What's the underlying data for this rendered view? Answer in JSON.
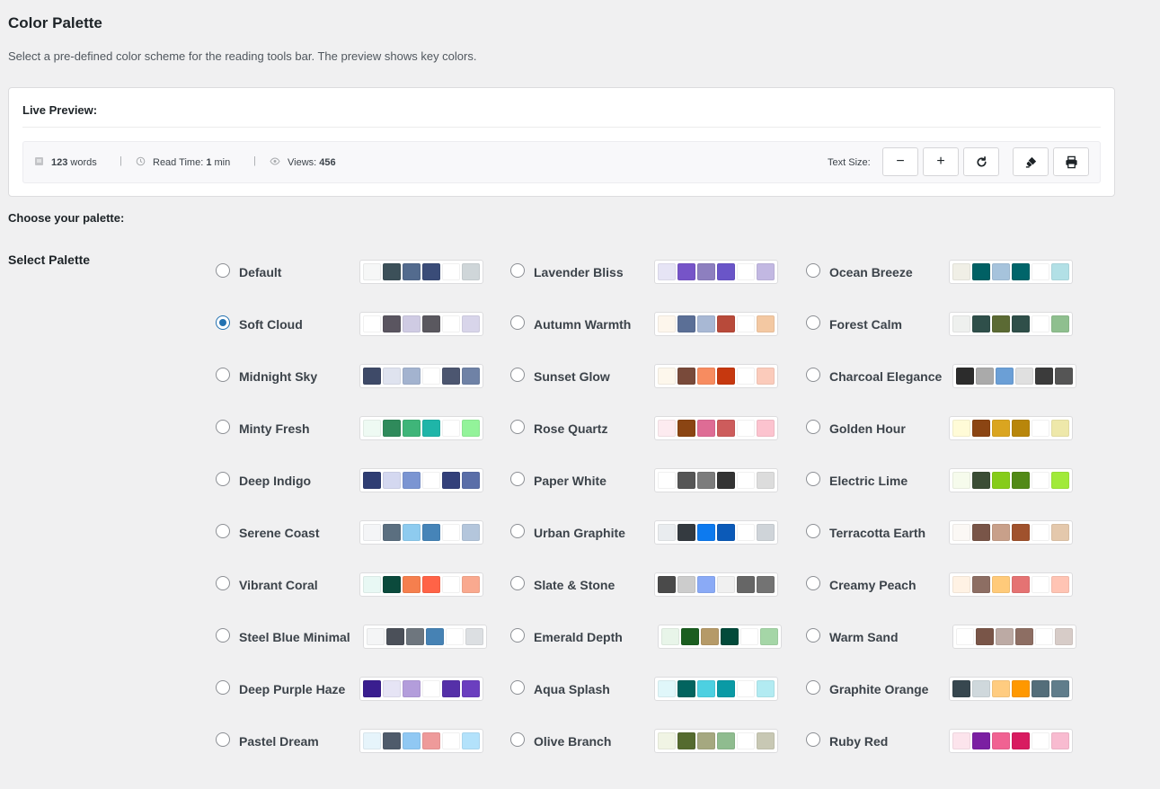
{
  "header": {
    "title": "Color Palette",
    "description": "Select a pre-defined color scheme for the reading tools bar. The preview shows key colors."
  },
  "preview": {
    "label": "Live Preview:",
    "words_value": "123",
    "words_unit": "words",
    "read_time_label": "Read Time:",
    "read_time_value": "1",
    "read_time_unit": "min",
    "views_label": "Views:",
    "views_value": "456",
    "separator": "|",
    "text_size_label": "Text Size:",
    "decrease_symbol": "−",
    "increase_symbol": "+",
    "icons": {
      "words": "document-icon",
      "read_time": "clock-icon",
      "views": "eye-icon",
      "reset": "reset-icon",
      "highlight": "highlighter-icon",
      "print": "print-icon"
    }
  },
  "choose_label": "Choose your palette:",
  "select_label": "Select Palette",
  "selected": "Soft Cloud",
  "columns": [
    [
      {
        "name": "Default",
        "colors": [
          "#f6f7f7",
          "#3c5059",
          "#536b8e",
          "#3a4c78",
          "#ffffff",
          "#cfd6d9"
        ]
      },
      {
        "name": "Soft Cloud",
        "colors": [
          "#ffffff",
          "#5a5560",
          "#cfcbe3",
          "#5a585f",
          "#ffffff",
          "#d8d5ea"
        ]
      },
      {
        "name": "Midnight Sky",
        "colors": [
          "#3e4a68",
          "#dfe3ef",
          "#a3b3cf",
          "#ffffff",
          "#4c5670",
          "#6f82a6"
        ]
      },
      {
        "name": "Minty Fresh",
        "colors": [
          "#eefaf3",
          "#2f8a5b",
          "#3fb579",
          "#1fb5a8",
          "#ffffff",
          "#93f39a"
        ]
      },
      {
        "name": "Deep Indigo",
        "colors": [
          "#2f3d73",
          "#d4d8f0",
          "#7b95d2",
          "#ffffff",
          "#33407a",
          "#5a6ea8"
        ]
      },
      {
        "name": "Serene Coast",
        "colors": [
          "#f4f5f7",
          "#5b6f80",
          "#8ecbef",
          "#4684b8",
          "#ffffff",
          "#b4c6dc"
        ]
      },
      {
        "name": "Vibrant Coral",
        "colors": [
          "#e8f8f4",
          "#0b4a3c",
          "#f57f4e",
          "#ff6347",
          "#ffffff",
          "#f9a98f"
        ]
      },
      {
        "name": "Steel Blue Minimal",
        "colors": [
          "#f4f5f6",
          "#4b5059",
          "#6e767e",
          "#4682b4",
          "#ffffff",
          "#dcdfe2"
        ]
      },
      {
        "name": "Deep Purple Haze",
        "colors": [
          "#3a1e8f",
          "#e6e4f5",
          "#b39ddb",
          "#ffffff",
          "#5530a8",
          "#6b3fbf"
        ]
      },
      {
        "name": "Pastel Dream",
        "colors": [
          "#e6f4fb",
          "#4f5b6b",
          "#90c8f3",
          "#ee9a9a",
          "#ffffff",
          "#b3e2fb"
        ]
      }
    ],
    [
      {
        "name": "Lavender Bliss",
        "colors": [
          "#e6e4f5",
          "#7654c8",
          "#8d7fbf",
          "#6a55c8",
          "#ffffff",
          "#c2b8e2"
        ]
      },
      {
        "name": "Autumn Warmth",
        "colors": [
          "#fdf6ec",
          "#5b6f96",
          "#a8b8d4",
          "#b84a3a",
          "#ffffff",
          "#f3c8a2"
        ]
      },
      {
        "name": "Sunset Glow",
        "colors": [
          "#fdf7ec",
          "#794a3a",
          "#f78c60",
          "#c6380f",
          "#ffffff",
          "#fbcbbb"
        ]
      },
      {
        "name": "Rose Quartz",
        "colors": [
          "#fdebf0",
          "#8b4513",
          "#de6c95",
          "#cd5c5c",
          "#ffffff",
          "#fcc3cf"
        ]
      },
      {
        "name": "Paper White",
        "colors": [
          "#ffffff",
          "#565656",
          "#7c7c7c",
          "#333333",
          "#ffffff",
          "#dcdcdc"
        ]
      },
      {
        "name": "Urban Graphite",
        "colors": [
          "#e9ecef",
          "#343a40",
          "#0d7aef",
          "#0b5ab8",
          "#ffffff",
          "#cfd4d9"
        ]
      },
      {
        "name": "Slate & Stone",
        "colors": [
          "#4a4a4a",
          "#cccccc",
          "#8aaaf6",
          "#f0f0f0",
          "#666666",
          "#737373"
        ]
      },
      {
        "name": "Emerald Depth",
        "colors": [
          "#e8f5e9",
          "#1b5e20",
          "#b59a68",
          "#024a3a",
          "#ffffff",
          "#a5d6a7"
        ]
      },
      {
        "name": "Aqua Splash",
        "colors": [
          "#e0f7fa",
          "#02645f",
          "#4dd0e1",
          "#0a9aa5",
          "#ffffff",
          "#b2ebf2"
        ]
      },
      {
        "name": "Olive Branch",
        "colors": [
          "#f0f4e4",
          "#556b2f",
          "#a5a880",
          "#8fbc8f",
          "#ffffff",
          "#c8c8b4"
        ]
      }
    ],
    [
      {
        "name": "Ocean Breeze",
        "colors": [
          "#f0efe6",
          "#006064",
          "#a6c3dc",
          "#00656a",
          "#ffffff",
          "#b2e0e6"
        ]
      },
      {
        "name": "Forest Calm",
        "colors": [
          "#eef0ee",
          "#2f4f4a",
          "#5b6a34",
          "#2f4f49",
          "#ffffff",
          "#8fbf8f"
        ]
      },
      {
        "name": "Charcoal Elegance",
        "colors": [
          "#2c2c2c",
          "#aaaaaa",
          "#6b9fd6",
          "#e0e0e0",
          "#3b3b3b",
          "#555555"
        ]
      },
      {
        "name": "Golden Hour",
        "colors": [
          "#fffbd7",
          "#8b4513",
          "#daa520",
          "#b8860b",
          "#ffffff",
          "#eee8aa"
        ]
      },
      {
        "name": "Electric Lime",
        "colors": [
          "#f6fbec",
          "#3b4d35",
          "#86cc1a",
          "#528a17",
          "#ffffff",
          "#a1ea3a"
        ]
      },
      {
        "name": "Terracotta Earth",
        "colors": [
          "#fbf8f5",
          "#795548",
          "#c8a08a",
          "#a0522d",
          "#ffffff",
          "#e4c8ac"
        ]
      },
      {
        "name": "Creamy Peach",
        "colors": [
          "#fff2e4",
          "#8d6e63",
          "#ffca7a",
          "#e57373",
          "#ffffff",
          "#ffc4b4"
        ]
      },
      {
        "name": "Warm Sand",
        "colors": [
          "#ffffff",
          "#795548",
          "#bcaaa4",
          "#8d6e63",
          "#ffffff",
          "#d7ccc8"
        ]
      },
      {
        "name": "Graphite Orange",
        "colors": [
          "#37474f",
          "#cfd8dc",
          "#ffcc80",
          "#ff9800",
          "#546e7a",
          "#607d8b"
        ]
      },
      {
        "name": "Ruby Red",
        "colors": [
          "#fce4ec",
          "#7b1fa2",
          "#f06292",
          "#d81b60",
          "#ffffff",
          "#f8bbd0"
        ]
      }
    ]
  ]
}
